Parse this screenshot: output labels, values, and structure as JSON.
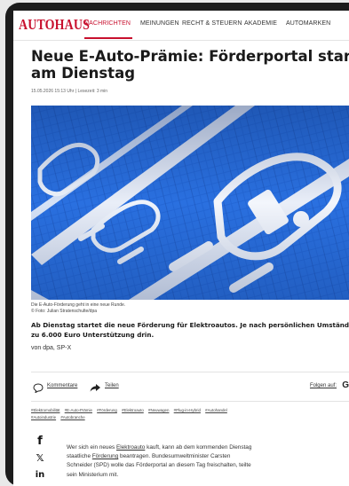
{
  "brand": {
    "logo": "AUTOHAUS",
    "color": "#c8102e"
  },
  "nav": {
    "items": [
      {
        "label": "NACHRICHTEN",
        "active": true
      },
      {
        "label": "MEINUNGEN",
        "active": false
      },
      {
        "label": "RECHT & STEUERN",
        "active": false
      },
      {
        "label": "AKADEMIE",
        "active": false
      },
      {
        "label": "AUTOMARKEN",
        "active": false
      }
    ]
  },
  "article": {
    "headline_line1": "Neue E-Auto-Prämie: Förderportal startet",
    "headline_line2": "am Dienstag",
    "meta": "15.05.2026 15:13 Uhr | Lesezeit: 3 min",
    "image_caption": "Die E-Auto-Förderung geht in eine neue Runde.",
    "image_credit": "© Foto: Julian Stratenschulte/dpa",
    "lead_line1": "Ab Dienstag startet die neue Förderung für Elektroautos. Je nach persönlichen Umständen sind bis",
    "lead_line2": "zu 6.000 Euro Unterstützung drin.",
    "byline": "von dpa,  SP-X"
  },
  "actions": {
    "comments_label": "Kommentare",
    "share_label": "Teilen",
    "follow_label": "Folgen auf:",
    "follow_icon_letter": "G"
  },
  "tags": [
    "#Elektromobilität",
    "#E-Auto-Prämie",
    "#Förderung",
    "#Elektroauto",
    "#Neuwagen",
    "#Plug-in-Hybrid",
    "#Autohandel",
    "#Autoindustrie",
    "#Autobranche"
  ],
  "social": [
    {
      "icon": "facebook-icon",
      "glyph": "f"
    },
    {
      "icon": "x-icon",
      "glyph": "𝕏"
    },
    {
      "icon": "linkedin-icon",
      "glyph": "in"
    }
  ],
  "body": {
    "l1_a": "Wer sich ein neues ",
    "l1_link": "Elektroauto",
    "l1_b": " kauft, kann ab dem kommenden Dienstag",
    "l2_a": "staatliche ",
    "l2_link": "Förderung",
    "l2_b": " beantragen. Bundesumweltminister Carsten",
    "l3": "Schneider (SPD) wolle das Förderportal an diesem Tag freischalten, teilte",
    "l4": "sein Ministerium mit."
  },
  "colors": {
    "accent": "#c8102e",
    "parking_blue": "#2466d8",
    "text": "#1a1a1a"
  }
}
